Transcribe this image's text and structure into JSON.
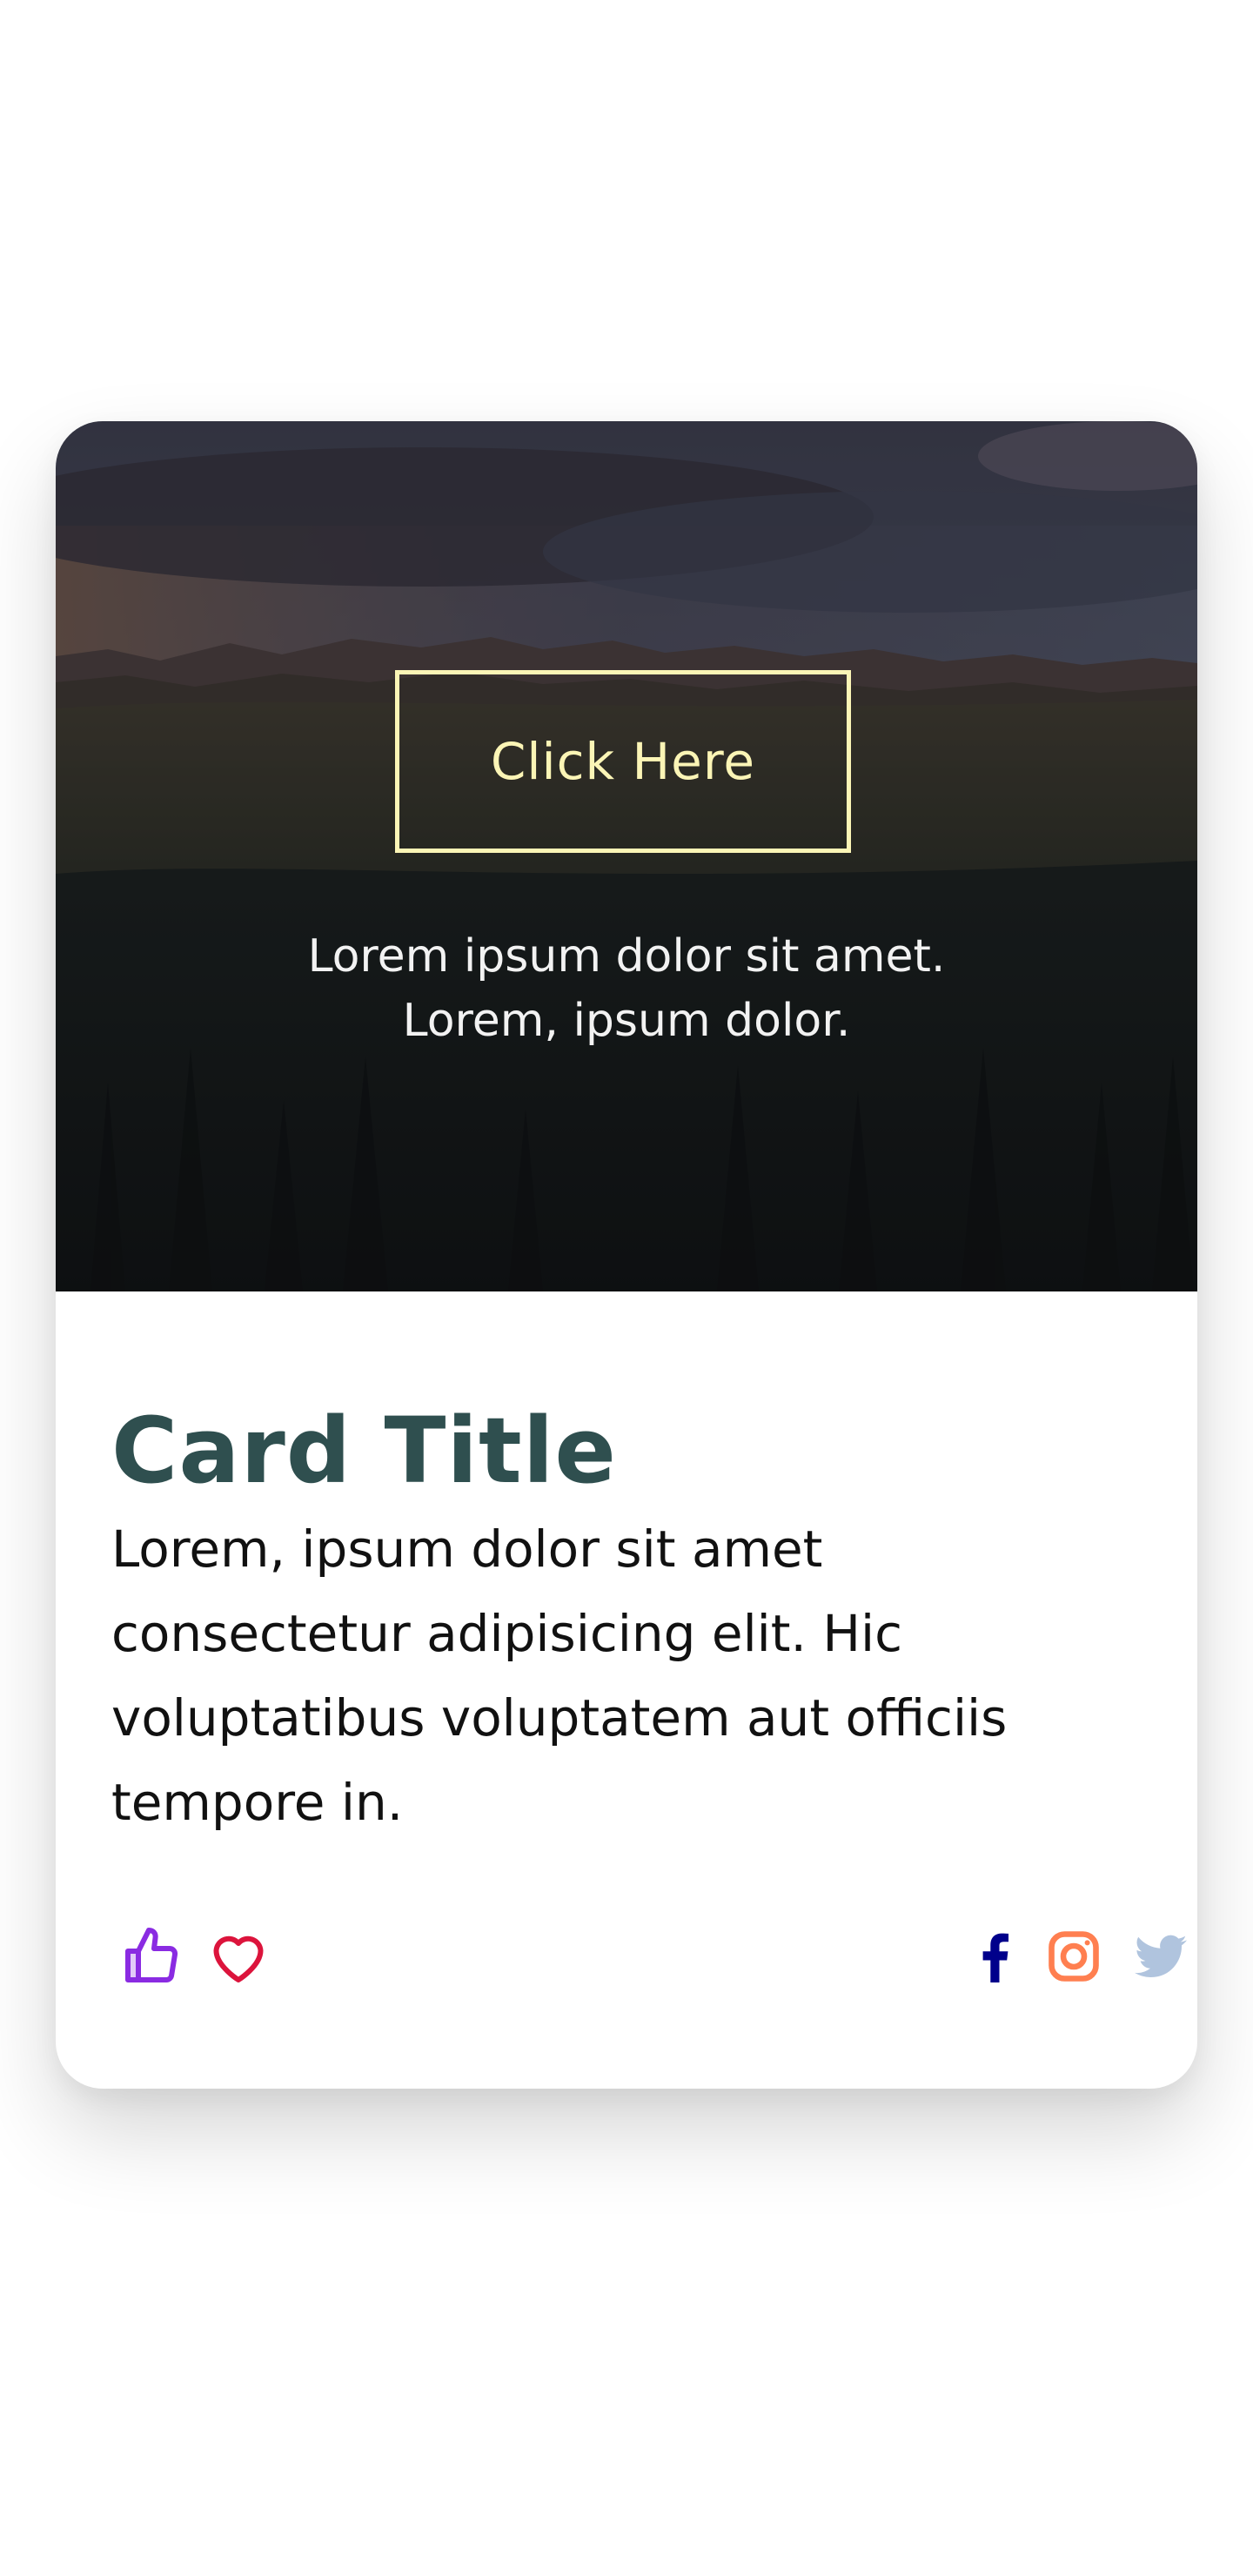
{
  "hero": {
    "button_label": "Click Here",
    "caption_line1": "Lorem ipsum dolor sit amet.",
    "caption_line2": "Lorem, ipsum dolor."
  },
  "card": {
    "title": "Card Title",
    "text": "Lorem, ipsum dolor sit amet\nconsectetur adipisicing elit. Hic\nvoluptatibus voluptatem aut officiis\ntempore in."
  },
  "actions": {
    "like_icon": "thumbs-up-icon",
    "favorite_icon": "heart-icon"
  },
  "social": {
    "facebook_icon": "facebook-icon",
    "instagram_icon": "instagram-icon",
    "twitter_icon": "twitter-icon"
  },
  "colors": {
    "title": "#2f4f4f",
    "button_border": "#fbf5b6",
    "like": "#8a2be2",
    "heart": "#dc143c",
    "facebook": "#00008b",
    "instagram": "#ff7f50",
    "twitter": "#b0c4de"
  }
}
